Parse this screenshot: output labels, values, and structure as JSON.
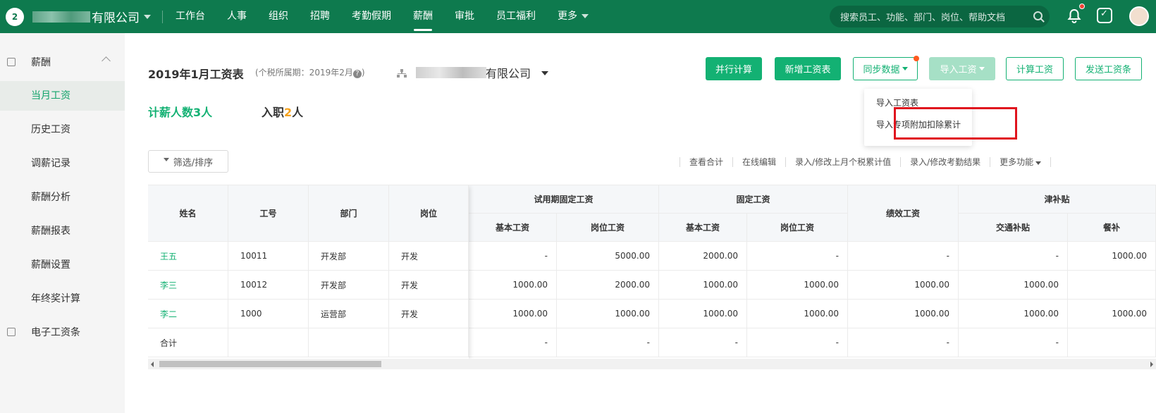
{
  "topbar": {
    "logo_text": "2",
    "company_name": "有限公司",
    "nav": [
      {
        "label": "工作台"
      },
      {
        "label": "人事"
      },
      {
        "label": "组织"
      },
      {
        "label": "招聘"
      },
      {
        "label": "考勤假期"
      },
      {
        "label": "薪酬",
        "active": true
      },
      {
        "label": "审批"
      },
      {
        "label": "员工福利"
      },
      {
        "label": "更多"
      }
    ],
    "search_placeholder": "搜索员工、功能、部门、岗位、帮助文档"
  },
  "sidebar": {
    "section1": "薪酬",
    "items": [
      "当月工资",
      "历史工资",
      "调薪记录",
      "薪酬分析",
      "薪酬报表",
      "薪酬设置",
      "年终奖计算"
    ],
    "section2": "电子工资条"
  },
  "header": {
    "title": "2019年1月工资表",
    "period": "(个税所属期：2019年2月",
    "period_help": "?",
    "period_close": ")",
    "org_name": "有限公司"
  },
  "buttons": {
    "parallel": "并行计算",
    "new_sheet": "新增工资表",
    "sync": "同步数据",
    "import": "导入工资",
    "calc": "计算工资",
    "send": "发送工资条"
  },
  "import_menu": [
    "导入工资表",
    "导入专项附加扣除累计"
  ],
  "stats": {
    "payroll_label": "计薪人数",
    "payroll_count": "3",
    "unit": "人",
    "joined_label": "入职",
    "joined_count": "2"
  },
  "filter_label": "筛选/排序",
  "actions": [
    "查看合计",
    "在线编辑",
    "录入/修改上月个税累计值",
    "录入/修改考勤结果",
    "更多功能"
  ],
  "table": {
    "fixed_headers": [
      "姓名",
      "工号",
      "部门",
      "岗位"
    ],
    "group_headers": [
      "试用期固定工资",
      "固定工资",
      "绩效工资",
      "津补贴"
    ],
    "sub_headers": [
      "基本工资",
      "岗位工资",
      "基本工资",
      "岗位工资",
      "交通补贴",
      "餐补"
    ],
    "rows": [
      {
        "name": "王五",
        "id": "10011",
        "dept": "开发部",
        "pos": "开发",
        "vals": [
          "-",
          "5000.00",
          "2000.00",
          "-",
          "-",
          "-",
          "1000.00"
        ]
      },
      {
        "name": "李三",
        "id": "10012",
        "dept": "开发部",
        "pos": "开发",
        "vals": [
          "1000.00",
          "2000.00",
          "1000.00",
          "1000.00",
          "1000.00",
          "1000.00",
          ""
        ]
      },
      {
        "name": "李二",
        "id": "1000",
        "dept": "运营部",
        "pos": "开发",
        "vals": [
          "1000.00",
          "1000.00",
          "1000.00",
          "1000.00",
          "1000.00",
          "1000.00",
          "1000.00"
        ]
      }
    ],
    "total_label": "合计",
    "total_vals": [
      "-",
      "-",
      "-",
      "-",
      "-",
      "-",
      ""
    ]
  }
}
